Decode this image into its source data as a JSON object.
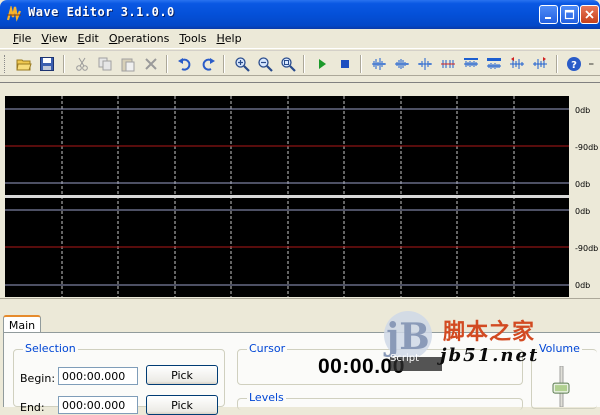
{
  "window": {
    "title": "Wave Editor 3.1.0.0"
  },
  "menu": {
    "items": [
      {
        "label": "File",
        "u": "F",
        "rest": "ile"
      },
      {
        "label": "View",
        "u": "V",
        "rest": "iew"
      },
      {
        "label": "Edit",
        "u": "E",
        "rest": "dit"
      },
      {
        "label": "Operations",
        "u": "O",
        "rest": "perations"
      },
      {
        "label": "Tools",
        "u": "T",
        "rest": "ools"
      },
      {
        "label": "Help",
        "u": "H",
        "rest": "elp"
      }
    ]
  },
  "toolbar": {
    "icons": [
      "open-folder-icon",
      "save-icon",
      "cut-icon",
      "copy-icon",
      "paste-icon",
      "delete-icon",
      "undo-icon",
      "redo-icon",
      "zoom-in-icon",
      "zoom-out-icon",
      "zoom-fit-icon",
      "play-icon",
      "stop-icon",
      "amplify-icon",
      "normalize-icon",
      "fade-icon",
      "silence-icon",
      "echo-icon",
      "reverse-left-icon",
      "reverse-right-icon",
      "help-icon"
    ]
  },
  "waveform": {
    "channel1": {
      "top": "0db",
      "mid": "-90db",
      "bottom": "0db"
    },
    "channel2": {
      "top": "0db",
      "mid": "-90db",
      "bottom": "0db"
    },
    "background": "#000000",
    "grid_color": "#c0c0c0",
    "center_line_color": "#b01818"
  },
  "tabs": {
    "main": "Main"
  },
  "selection": {
    "label": "Selection",
    "begin_label": "Begin:",
    "begin_value": "000:00.000",
    "end_label": "End:",
    "end_value": "000:00.000",
    "pick_label": "Pick"
  },
  "cursor": {
    "label": "Cursor",
    "time": "00:00.00",
    "script": "Script"
  },
  "levels": {
    "label": "Levels"
  },
  "volume": {
    "label": "Volume",
    "level": 0.45
  },
  "watermark": {
    "logo": "jB",
    "cn": "脚本之家",
    "url": "jb51.net"
  }
}
